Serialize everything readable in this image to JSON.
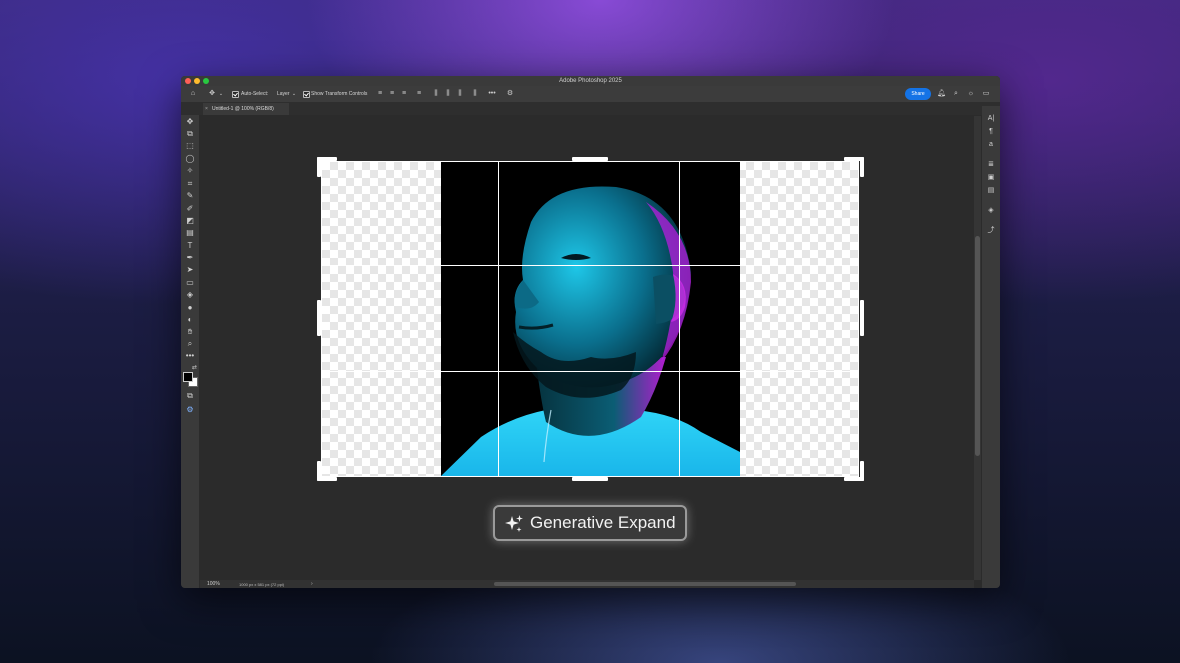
{
  "window": {
    "title": "Adobe Photoshop 2025"
  },
  "options_bar": {
    "auto_select_label": "Auto-Select:",
    "auto_select_value": "Layer",
    "show_transform_label": "Show Transform Controls",
    "share_label": "Share"
  },
  "document_tab": {
    "label": "Untitled-1 @ 100% (RGB/8)",
    "close_glyph": "×"
  },
  "status_bar": {
    "zoom": "100%",
    "doc_info": "1000 px x 581 px (72 ppi)",
    "chevron": "›"
  },
  "canvas": {
    "generative_expand_label": "Generative Expand"
  },
  "icons": {
    "toolbar": [
      "move-icon",
      "artboard-icon",
      "marquee-icon",
      "lasso-icon",
      "magic-wand-icon",
      "crop-icon",
      "eyedropper-icon",
      "brush-icon",
      "eraser-icon",
      "gradient-icon",
      "type-icon",
      "pen-icon",
      "path-select-icon",
      "rectangle-icon",
      "paint-bucket-icon",
      "blur-icon",
      "dodge-icon",
      "hand-icon",
      "zoom-icon",
      "more-tools-icon"
    ],
    "right_panel": [
      "character-icon",
      "paragraph-icon",
      "glyphs-icon",
      "adjustments-icon",
      "libraries-icon",
      "properties-icon",
      "layers-icon",
      "paths-icon"
    ]
  },
  "colors": {
    "accent": "#1473e6",
    "background_top": "#3a2a78",
    "background_bottom": "#0c1222",
    "ui_dark": "#2b2b2b",
    "ui_panel": "#3a3a3a"
  }
}
